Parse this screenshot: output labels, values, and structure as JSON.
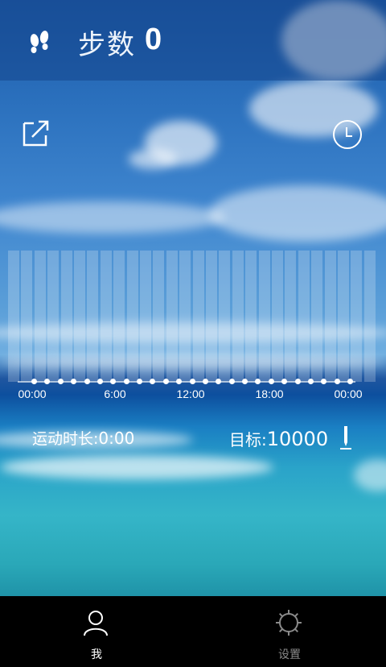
{
  "header": {
    "icon": "footprints-icon",
    "title": "步数",
    "step_count": "0"
  },
  "toolbar": {
    "share_icon": "share-external-icon",
    "history_icon": "clock-icon"
  },
  "timeline": {
    "hourly_bar_count": 28,
    "dot_count": 25,
    "ticks": [
      "00:00",
      "6:00",
      "12:00",
      "18:00",
      "00:00"
    ]
  },
  "stats": {
    "duration_label": "运动时长:",
    "duration_value": "0:00",
    "goal_label": "目标:",
    "goal_value": "10000",
    "edit_icon": "pencil-icon"
  },
  "tabs": [
    {
      "label": "我",
      "icon": "person-icon",
      "active": true,
      "color": "#ffffff"
    },
    {
      "label": "设置",
      "icon": "settings-gear-icon",
      "active": false,
      "color": "#8a8a8a"
    }
  ]
}
